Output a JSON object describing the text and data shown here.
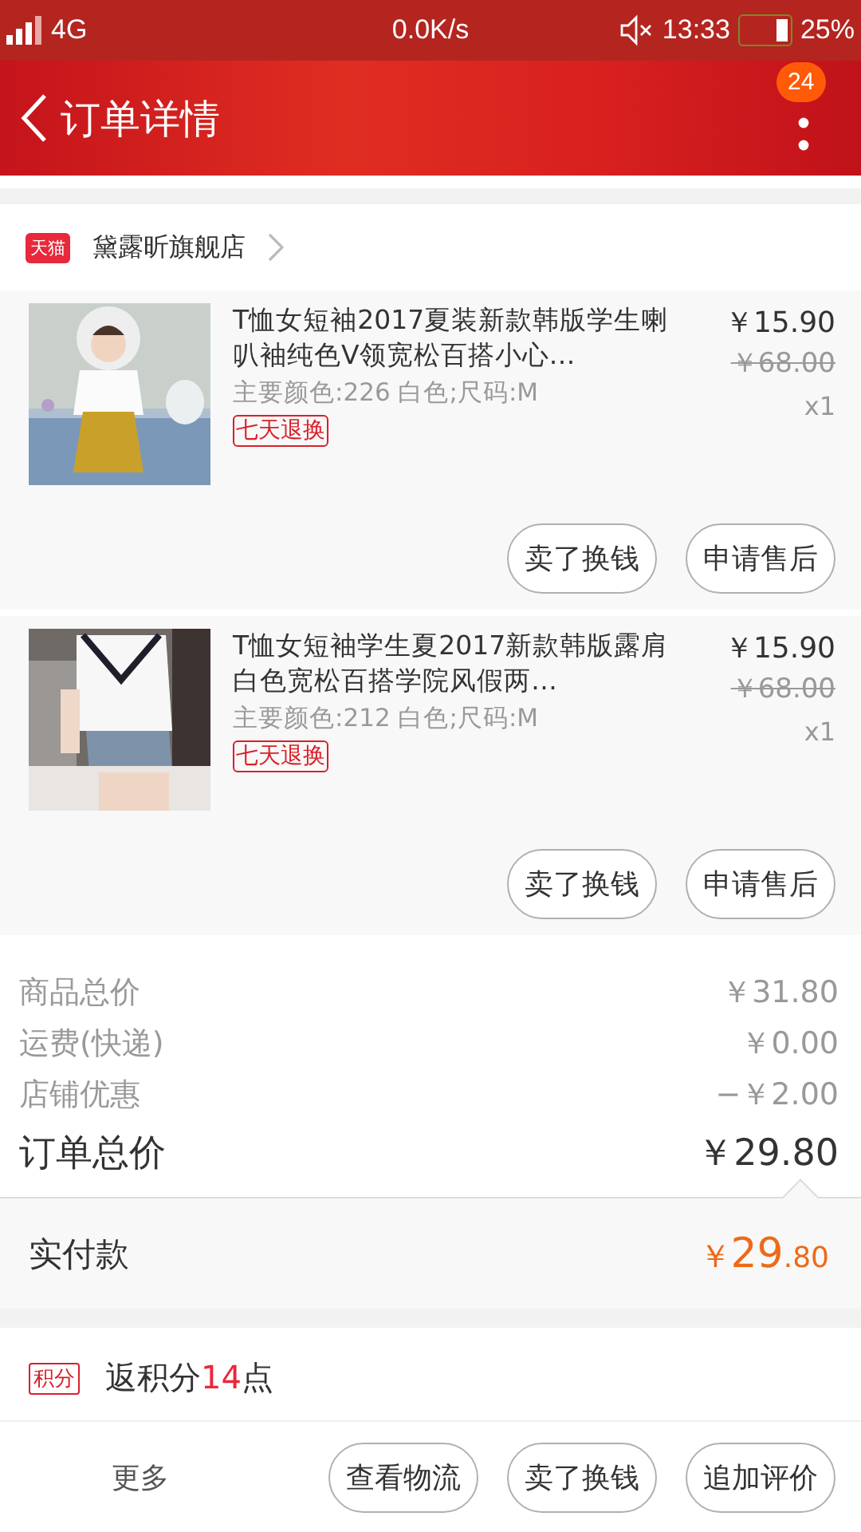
{
  "status_bar": {
    "network": "4G",
    "speed": "0.0K/s",
    "time": "13:33",
    "battery": "25%"
  },
  "header": {
    "title": "订单详情",
    "badge": "24"
  },
  "store": {
    "badge": "天猫",
    "name": "黛露昕旗舰店"
  },
  "items": [
    {
      "title": "T恤女短袖2017夏装新款韩版学生喇叭袖纯色V领宽松百搭小心…",
      "spec": "主要颜色:226 白色;尺码:M",
      "tag": "七天退换",
      "price": "￥15.90",
      "original_price": "￥68.00",
      "quantity": "x1",
      "buttons": [
        "卖了换钱",
        "申请售后"
      ]
    },
    {
      "title": "T恤女短袖学生夏2017新款韩版露肩白色宽松百搭学院风假两…",
      "spec": "主要颜色:212 白色;尺码:M",
      "tag": "七天退换",
      "price": "￥15.90",
      "original_price": "￥68.00",
      "quantity": "x1",
      "buttons": [
        "卖了换钱",
        "申请售后"
      ]
    }
  ],
  "summary": [
    {
      "label": "商品总价",
      "value": "￥31.80",
      "kind": "minor"
    },
    {
      "label": "运费(快递)",
      "value": "￥0.00",
      "kind": "minor"
    },
    {
      "label": "店铺优惠",
      "value": "−￥2.00",
      "kind": "minor"
    },
    {
      "label": "订单总价",
      "value": "￥29.80",
      "kind": "total"
    }
  ],
  "paid": {
    "label": "实付款",
    "currency": "￥",
    "integer": "29",
    "decimal": ".80"
  },
  "points": {
    "badge": "积分",
    "prefix": "返积分",
    "amount": "14",
    "suffix": "点"
  },
  "bottom_bar": {
    "more": "更多",
    "buttons": [
      "查看物流",
      "卖了换钱",
      "追加评价"
    ]
  }
}
